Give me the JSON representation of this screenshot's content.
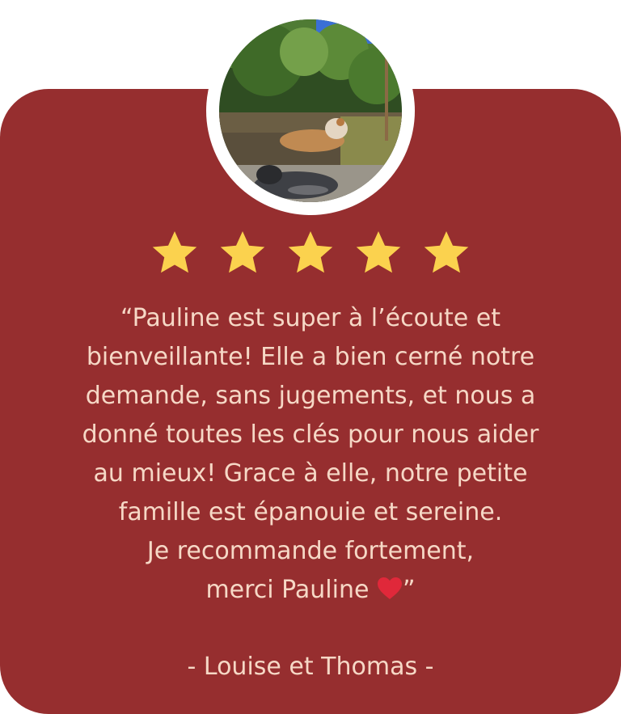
{
  "testimonial": {
    "rating": 5,
    "rating_max": 5,
    "quote_lines": [
      "“Pauline est super à l’écoute et",
      "bienveillante! Elle a bien cerné notre",
      "demande, sans jugements, et nous a",
      "donné toutes les clés pour nous aider",
      "au mieux! Grace à elle, notre petite",
      "famille est épanouie et sereine.",
      "Je recommande fortement,",
      "merci Pauline"
    ],
    "quote_close": "”",
    "author": "- Louise et Thomas -",
    "avatar_icon": "dogs-photo",
    "heart_icon": "heart-icon"
  },
  "colors": {
    "card_background": "#962e2f",
    "text": "#f6d8c6",
    "star": "#fbd24e",
    "heart": "#e0283a"
  }
}
